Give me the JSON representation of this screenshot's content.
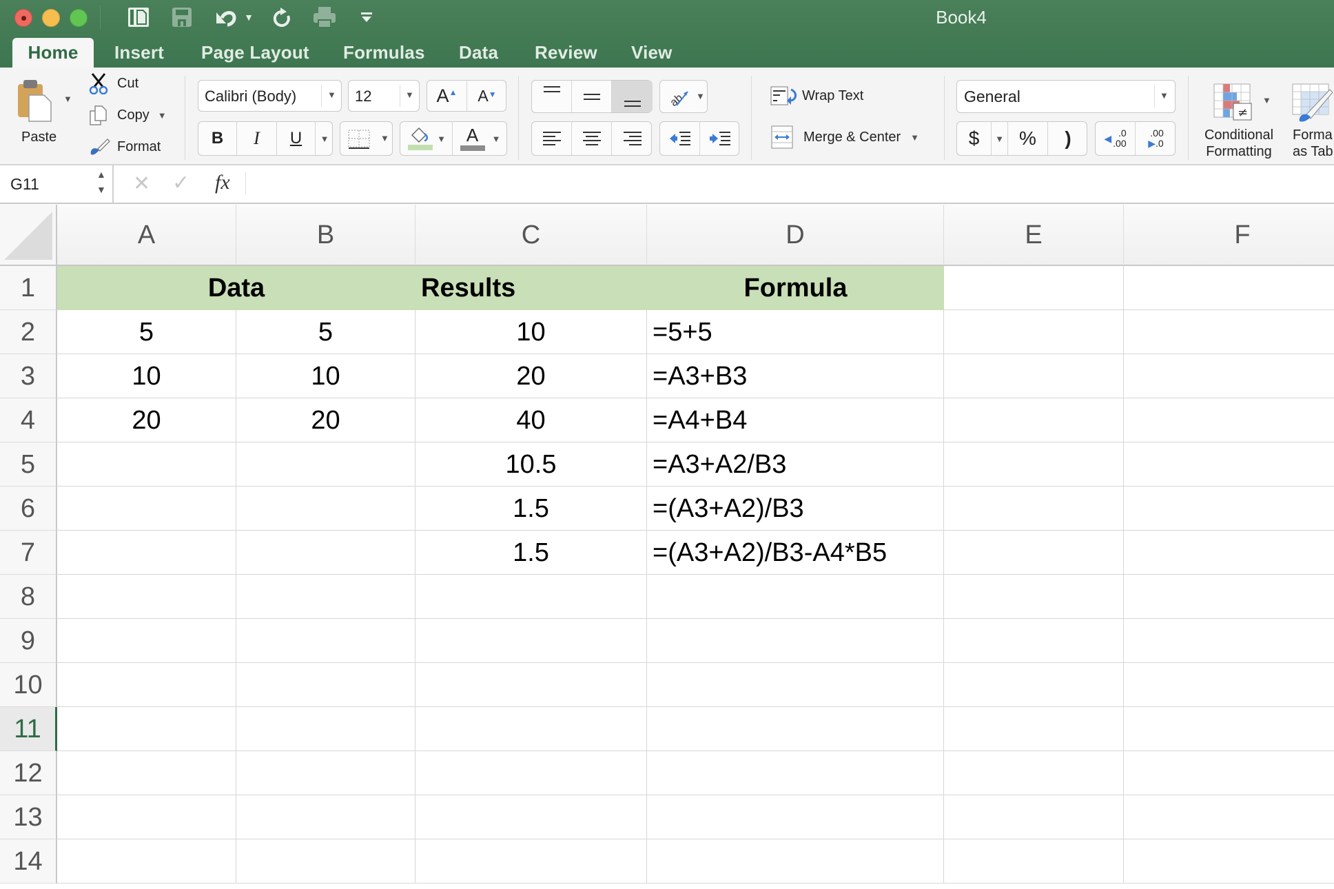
{
  "window": {
    "title": "Book4",
    "traffic_lights": [
      "close",
      "minimize",
      "zoom"
    ]
  },
  "quick_access": [
    {
      "name": "sidebar-icon",
      "enabled": true
    },
    {
      "name": "save-icon",
      "enabled": false
    },
    {
      "name": "undo-icon",
      "enabled": true
    },
    {
      "name": "undo-dropdown-icon",
      "enabled": true
    },
    {
      "name": "redo-icon",
      "enabled": true
    },
    {
      "name": "print-icon",
      "enabled": false
    },
    {
      "name": "customize-toolbar-icon",
      "enabled": true
    }
  ],
  "tabs": [
    {
      "label": "Home",
      "active": true
    },
    {
      "label": "Insert"
    },
    {
      "label": "Page Layout"
    },
    {
      "label": "Formulas"
    },
    {
      "label": "Data"
    },
    {
      "label": "Review"
    },
    {
      "label": "View"
    }
  ],
  "ribbon": {
    "clipboard": {
      "paste": "Paste",
      "cut": "Cut",
      "copy": "Copy",
      "format": "Format"
    },
    "font": {
      "name": "Calibri (Body)",
      "size": "12",
      "increase": "A",
      "decrease": "A",
      "bold": "B",
      "italic": "I",
      "underline": "U",
      "font_color": "A",
      "fill_color": "#c3dfb0",
      "text_color": "#8c8c8c"
    },
    "alignment": {
      "wrap_text": "Wrap Text",
      "merge_center": "Merge & Center",
      "active_vertical_align": "bottom"
    },
    "number": {
      "format": "General",
      "currency": "$",
      "percent": "%",
      "comma": ")",
      "inc_decimal_top": ".0",
      "inc_decimal_bottom": ".00",
      "dec_decimal_top": ".00",
      "dec_decimal_bottom": ".0"
    },
    "styles": {
      "conditional_formatting_line1": "Conditional",
      "conditional_formatting_line2": "Formatting",
      "format_as_table_line1": "Forma",
      "format_as_table_line2": "as Tab"
    }
  },
  "formula_bar": {
    "name_box": "G11",
    "cancel": "✕",
    "enter": "✓",
    "fx": "fx",
    "content": ""
  },
  "sheet": {
    "columns": [
      "A",
      "B",
      "C",
      "D",
      "E",
      "F"
    ],
    "rows": [
      "1",
      "2",
      "3",
      "4",
      "5",
      "6",
      "7",
      "8",
      "9",
      "10",
      "11",
      "12",
      "13",
      "14"
    ],
    "active_row": "11",
    "header_fill": "#c9dfb7",
    "header_row": {
      "data": "Data",
      "results": "Results",
      "formula": "Formula"
    },
    "data_rows": [
      {
        "A": "5",
        "B": "5",
        "C": "10",
        "D": "=5+5"
      },
      {
        "A": "10",
        "B": "10",
        "C": "20",
        "D": "=A3+B3"
      },
      {
        "A": "20",
        "B": "20",
        "C": "40",
        "D": "=A4+B4"
      },
      {
        "A": "",
        "B": "",
        "C": "10.5",
        "D": "=A3+A2/B3"
      },
      {
        "A": "",
        "B": "",
        "C": "1.5",
        "D": "=(A3+A2)/B3"
      },
      {
        "A": "",
        "B": "",
        "C": "1.5",
        "D": "=(A3+A2)/B3-A4*B5"
      }
    ]
  },
  "colors": {
    "title_bar": "#417a53",
    "accent": "#2f6b45"
  }
}
